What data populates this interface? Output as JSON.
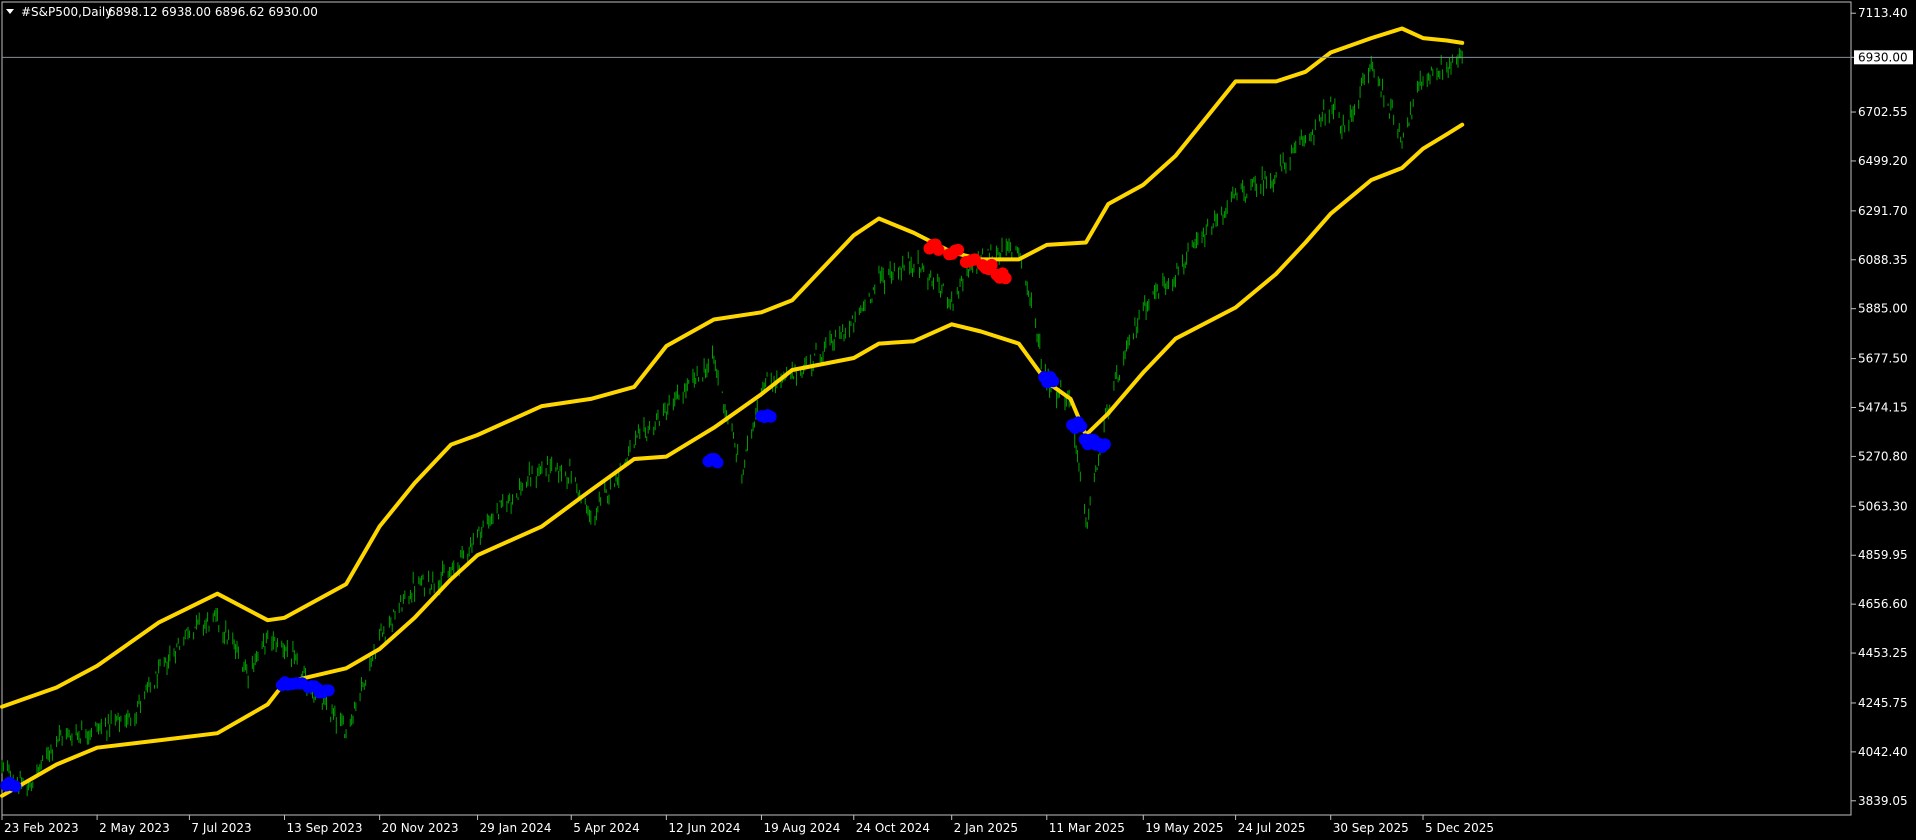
{
  "header": {
    "symbol": "#S&P500,Daily",
    "ohlc": "6898.12 6938.00 6896.62 6930.00"
  },
  "current_price_label": "6930.00",
  "colors": {
    "background": "#000000",
    "frame": "#c0c0c0",
    "price_line": "#8090a0",
    "candle": "#00a000",
    "band": "#ffd700",
    "marker_lower": "#0000ff",
    "marker_upper": "#ff0000",
    "text": "#ffffff"
  },
  "chart_data": {
    "type": "line",
    "title": "",
    "y_range": [
      3780,
      7160
    ],
    "y_ticks": [
      3839.05,
      4042.4,
      4245.75,
      4453.25,
      4656.6,
      4859.95,
      5063.3,
      5270.8,
      5474.15,
      5677.5,
      5885.0,
      6088.35,
      6291.7,
      6499.2,
      6702.55,
      6930.0,
      7113.4
    ],
    "y_tick_labels": [
      "3839.05",
      "4042.40",
      "4245.75",
      "4453.25",
      "4656.60",
      "4859.95",
      "5063.30",
      "5270.80",
      "5474.15",
      "5677.50",
      "5885.00",
      "6088.35",
      "6291.70",
      "6499.20",
      "6702.55",
      "6930.00",
      "7113.40"
    ],
    "x_range": [
      "2023-02-23",
      "2026-10-07"
    ],
    "x_ticks": [
      "2023-02-23",
      "2023-05-02",
      "2023-07-07",
      "2023-09-13",
      "2023-11-20",
      "2024-01-29",
      "2024-04-05",
      "2024-06-12",
      "2024-08-19",
      "2024-10-24",
      "2025-01-02",
      "2025-03-11",
      "2025-05-19",
      "2025-07-24",
      "2025-09-30",
      "2025-12-05"
    ],
    "x_tick_labels": [
      "23 Feb 2023",
      "2 May 2023",
      "7 Jul 2023",
      "13 Sep 2023",
      "20 Nov 2023",
      "29 Jan 2024",
      "5 Apr 2024",
      "12 Jun 2024",
      "19 Aug 2024",
      "24 Oct 2024",
      "2 Jan 2025",
      "11 Mar 2025",
      "19 May 2025",
      "24 Jul 2025",
      "30 Sep 2025",
      "5 Dec 2025"
    ],
    "series": [
      {
        "name": "",
        "role": "price",
        "x": [
          "2023-02-23",
          "2023-03-13",
          "2023-04-03",
          "2023-05-02",
          "2023-05-25",
          "2023-06-15",
          "2023-07-07",
          "2023-07-27",
          "2023-08-18",
          "2023-09-01",
          "2023-09-13",
          "2023-10-02",
          "2023-10-27",
          "2023-11-20",
          "2023-12-15",
          "2024-01-10",
          "2024-01-29",
          "2024-02-20",
          "2024-03-15",
          "2024-04-05",
          "2024-04-19",
          "2024-05-20",
          "2024-06-12",
          "2024-07-16",
          "2024-08-05",
          "2024-08-19",
          "2024-09-10",
          "2024-10-24",
          "2024-11-11",
          "2024-12-06",
          "2025-01-02",
          "2025-01-23",
          "2025-02-19",
          "2025-03-11",
          "2025-03-28",
          "2025-04-08",
          "2025-04-24",
          "2025-05-19",
          "2025-06-11",
          "2025-07-24",
          "2025-08-22",
          "2025-09-12",
          "2025-09-30",
          "2025-10-10",
          "2025-10-29",
          "2025-11-20",
          "2025-12-05",
          "2025-12-22",
          "2026-01-02"
        ],
        "y": [
          3980,
          3880,
          4100,
          4140,
          4180,
          4360,
          4560,
          4590,
          4380,
          4510,
          4480,
          4300,
          4130,
          4520,
          4730,
          4780,
          4950,
          5090,
          5220,
          5200,
          5000,
          5320,
          5460,
          5670,
          5190,
          5570,
          5600,
          5820,
          6010,
          6080,
          5920,
          6100,
          6140,
          5590,
          5500,
          4980,
          5480,
          5900,
          6030,
          6350,
          6440,
          6590,
          6720,
          6620,
          6900,
          6600,
          6840,
          6890,
          6930
        ]
      },
      {
        "name": "",
        "role": "upper-band",
        "x": [
          "2023-02-23",
          "2023-04-03",
          "2023-05-02",
          "2023-06-15",
          "2023-07-27",
          "2023-09-01",
          "2023-09-13",
          "2023-10-27",
          "2023-11-20",
          "2023-12-15",
          "2024-01-10",
          "2024-01-29",
          "2024-03-15",
          "2024-04-19",
          "2024-05-20",
          "2024-06-12",
          "2024-07-16",
          "2024-08-19",
          "2024-09-10",
          "2024-10-24",
          "2024-11-11",
          "2024-12-06",
          "2025-01-02",
          "2025-01-23",
          "2025-02-19",
          "2025-03-11",
          "2025-04-08",
          "2025-04-24",
          "2025-05-19",
          "2025-06-11",
          "2025-07-24",
          "2025-08-22",
          "2025-09-12",
          "2025-09-30",
          "2025-10-29",
          "2025-11-20",
          "2025-12-05",
          "2025-12-22",
          "2026-01-02"
        ],
        "y": [
          4230,
          4310,
          4400,
          4580,
          4700,
          4590,
          4600,
          4740,
          4980,
          5160,
          5320,
          5360,
          5480,
          5510,
          5560,
          5730,
          5840,
          5870,
          5920,
          6190,
          6260,
          6200,
          6120,
          6090,
          6090,
          6150,
          6160,
          6320,
          6400,
          6520,
          6830,
          6830,
          6870,
          6950,
          7010,
          7050,
          7010,
          7000,
          6990
        ]
      },
      {
        "name": "",
        "role": "lower-band",
        "x": [
          "2023-02-23",
          "2023-04-03",
          "2023-05-02",
          "2023-06-15",
          "2023-07-27",
          "2023-09-01",
          "2023-09-13",
          "2023-10-27",
          "2023-11-20",
          "2023-12-15",
          "2024-01-10",
          "2024-01-29",
          "2024-03-15",
          "2024-04-19",
          "2024-05-20",
          "2024-06-12",
          "2024-07-16",
          "2024-08-19",
          "2024-09-10",
          "2024-10-24",
          "2024-11-11",
          "2024-12-06",
          "2025-01-02",
          "2025-01-23",
          "2025-02-19",
          "2025-03-11",
          "2025-03-28",
          "2025-04-08",
          "2025-04-24",
          "2025-05-19",
          "2025-06-11",
          "2025-07-24",
          "2025-08-22",
          "2025-09-12",
          "2025-09-30",
          "2025-10-29",
          "2025-11-20",
          "2025-12-05",
          "2025-12-22",
          "2026-01-02"
        ],
        "y": [
          3860,
          3990,
          4060,
          4090,
          4120,
          4240,
          4330,
          4390,
          4470,
          4600,
          4760,
          4860,
          4980,
          5130,
          5260,
          5270,
          5390,
          5530,
          5630,
          5680,
          5740,
          5750,
          5820,
          5790,
          5740,
          5580,
          5510,
          5360,
          5450,
          5620,
          5760,
          5890,
          6030,
          6160,
          6280,
          6420,
          6470,
          6550,
          6610,
          6650
        ]
      }
    ],
    "markers": [
      {
        "x": "2023-03-01",
        "y": 3910,
        "color": "blue"
      },
      {
        "x": "2023-09-14",
        "y": 4320,
        "color": "blue"
      },
      {
        "x": "2023-09-22",
        "y": 4320,
        "color": "blue"
      },
      {
        "x": "2023-10-03",
        "y": 4310,
        "color": "blue"
      },
      {
        "x": "2023-10-11",
        "y": 4300,
        "color": "blue"
      },
      {
        "x": "2024-07-15",
        "y": 5250,
        "color": "blue"
      },
      {
        "x": "2024-08-22",
        "y": 5440,
        "color": "blue"
      },
      {
        "x": "2024-12-20",
        "y": 6140,
        "color": "red"
      },
      {
        "x": "2025-01-03",
        "y": 6120,
        "color": "red"
      },
      {
        "x": "2025-01-15",
        "y": 6090,
        "color": "red"
      },
      {
        "x": "2025-01-27",
        "y": 6060,
        "color": "red"
      },
      {
        "x": "2025-02-06",
        "y": 6020,
        "color": "red"
      },
      {
        "x": "2025-03-12",
        "y": 5590,
        "color": "blue"
      },
      {
        "x": "2025-04-01",
        "y": 5400,
        "color": "blue"
      },
      {
        "x": "2025-04-10",
        "y": 5330,
        "color": "blue"
      },
      {
        "x": "2025-04-18",
        "y": 5320,
        "color": "blue"
      }
    ],
    "grid": false,
    "legend": "none"
  }
}
